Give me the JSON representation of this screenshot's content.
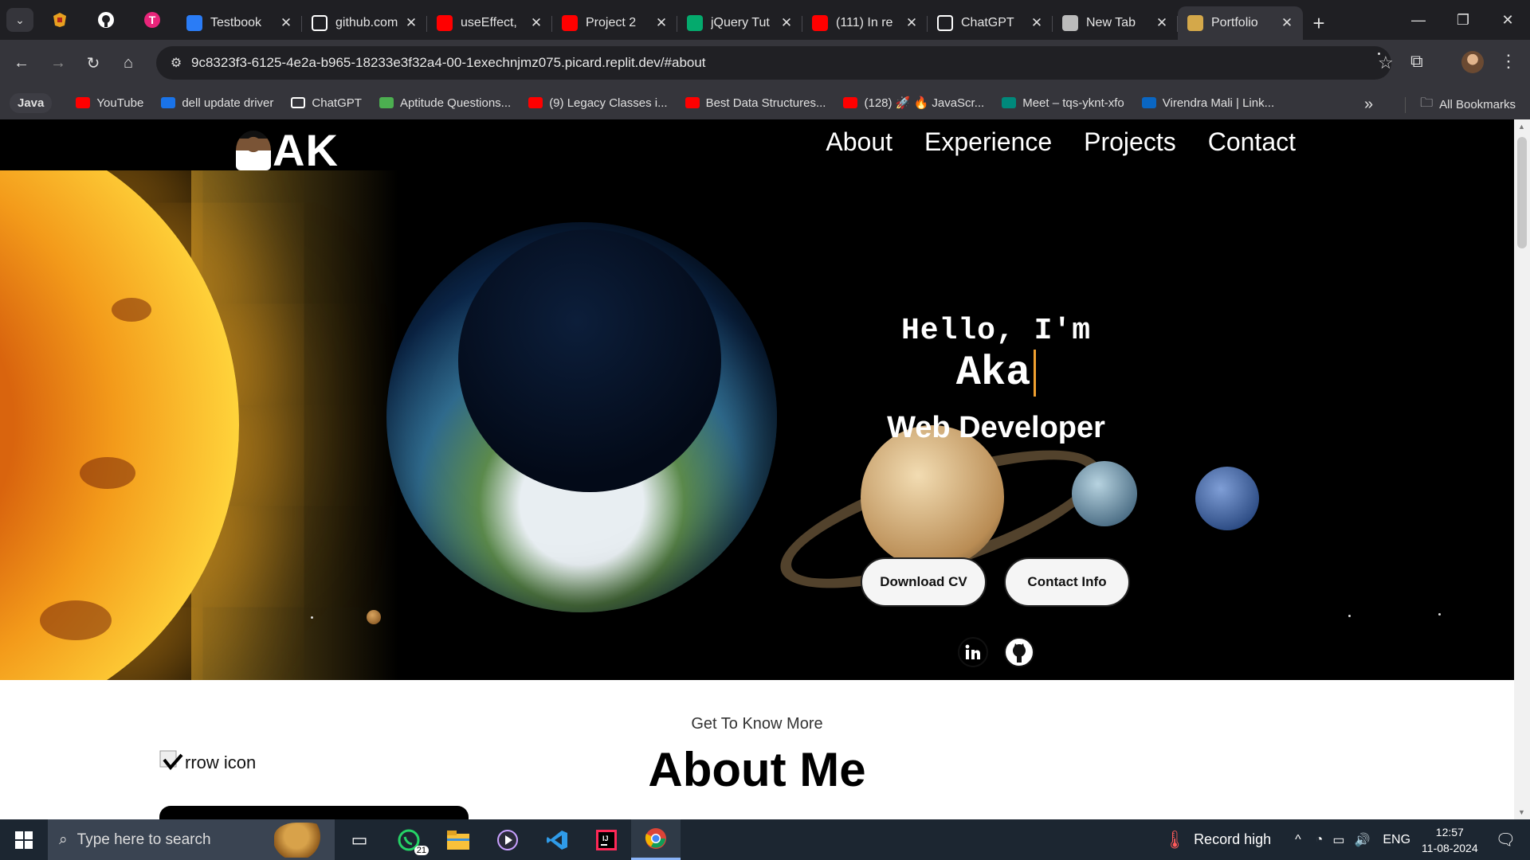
{
  "browser": {
    "tabs": [
      {
        "title": "Testbook",
        "favicon": "testbook-icon",
        "color": "#2a7cf6"
      },
      {
        "title": "github.com",
        "favicon": "github-icon",
        "color": "#ffffff"
      },
      {
        "title": "useEffect,",
        "favicon": "youtube-icon",
        "color": "#ff0000"
      },
      {
        "title": "Project 2",
        "favicon": "youtube-icon",
        "color": "#ff0000"
      },
      {
        "title": "jQuery Tut",
        "favicon": "w3schools-icon",
        "color": "#04aa6d"
      },
      {
        "title": "(111) In re",
        "favicon": "youtube-icon",
        "color": "#ff0000"
      },
      {
        "title": "ChatGPT",
        "favicon": "chatgpt-icon",
        "color": "#ffffff"
      },
      {
        "title": "New Tab",
        "favicon": "chrome-icon",
        "color": "#bbbbbb"
      },
      {
        "title": "Portfolio",
        "favicon": "ak-icon",
        "color": "#d4a84a",
        "active": true
      }
    ],
    "url": "9c8323f3-6125-4e2a-b965-18233e3f32a4-00-1exechnjmz075.picard.replit.dev/#about",
    "bookmarks": [
      {
        "label": "YouTube",
        "icon": "youtube-icon",
        "color": "#ff0000"
      },
      {
        "label": "dell update driver",
        "icon": "dell-icon",
        "color": "#1a73e8"
      },
      {
        "label": "ChatGPT",
        "icon": "chatgpt-icon",
        "color": "#ffffff"
      },
      {
        "label": "Aptitude Questions...",
        "icon": "indiabix-icon",
        "color": "#4caf50"
      },
      {
        "label": "(9) Legacy Classes i...",
        "icon": "youtube-icon",
        "color": "#ff0000"
      },
      {
        "label": "Best Data Structures...",
        "icon": "youtube-icon",
        "color": "#ff0000"
      },
      {
        "label": "(128) 🚀 🔥 JavaScr...",
        "icon": "youtube-icon",
        "color": "#ff0000"
      },
      {
        "label": "Meet – tqs-yknt-xfo",
        "icon": "meet-icon",
        "color": "#00897b"
      },
      {
        "label": "Virendra Mali | Link...",
        "icon": "linkedin-icon",
        "color": "#0a66c2"
      }
    ],
    "bookmark_folder": "Java",
    "all_bookmarks": "All Bookmarks",
    "overflow": "»"
  },
  "site": {
    "brand": "AK",
    "nav": [
      "About",
      "Experience",
      "Projects",
      "Contact"
    ],
    "hero": {
      "hello": "Hello, I'm",
      "name": "Aka",
      "role": "Web Developer",
      "buttons": [
        "Download CV",
        "Contact Info"
      ],
      "socials": [
        "linkedin-icon",
        "github-icon"
      ]
    },
    "about": {
      "subtitle": "Get To Know More",
      "title": "About Me",
      "broken_image_alt": "Arrow icon",
      "broken_image_visible_text": "rrow icon"
    }
  },
  "taskbar": {
    "search_placeholder": "Type here to search",
    "whatsapp_badge": "21",
    "weather": "Record high",
    "language": "ENG",
    "time": "12:57",
    "date": "11-08-2024"
  }
}
